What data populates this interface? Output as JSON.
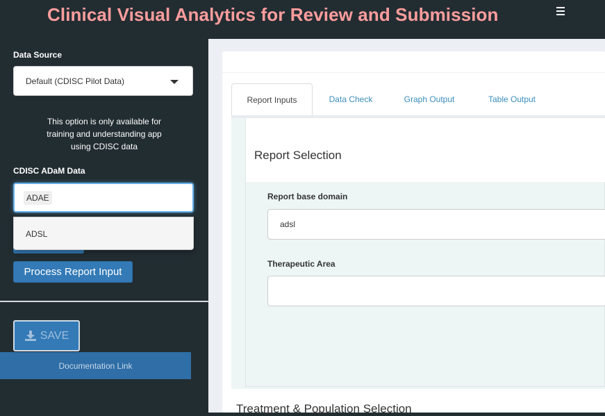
{
  "header": {
    "title": "Clinical Visual Analytics for Review and Submission"
  },
  "sidebar": {
    "data_source_label": "Data Source",
    "data_source_value": "Default (CDISC Pilot Data)",
    "note_lines": [
      "This option is only available for",
      "training and understanding app",
      "using CDISC data"
    ],
    "adam_label": "CDISC ADaM Data",
    "adam_selected": "ADAE",
    "adam_option": "ADSL",
    "process_button": "Process Report Input",
    "save_button": "SAVE",
    "doc_link": "Documentation Link"
  },
  "main": {
    "tabs": [
      {
        "label": "Report Inputs"
      },
      {
        "label": "Data Check"
      },
      {
        "label": "Graph Output"
      },
      {
        "label": "Table Output"
      }
    ],
    "section_title": "Report Selection",
    "report_base_label": "Report base domain",
    "report_base_value": "adsl",
    "therapeutic_label": "Therapeutic Area",
    "therapeutic_value": "",
    "next_section": "Treatment & Population Selection"
  },
  "icons": {
    "menu": "hamburger-icon",
    "save": "download-icon",
    "caret": "caret-down-icon"
  },
  "colors": {
    "title": "#ff9d9d",
    "sidebar_bg": "#222d32",
    "primary": "#337ab7",
    "tab_link": "#3c8dbc"
  }
}
